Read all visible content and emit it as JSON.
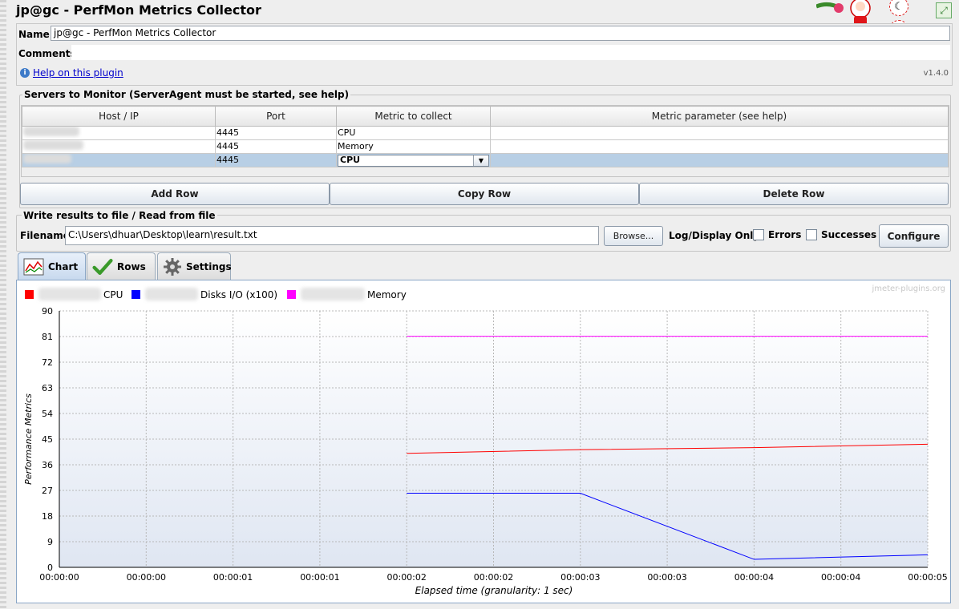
{
  "window": {
    "title": "jp@gc - PerfMon Metrics Collector"
  },
  "form": {
    "name_label": "Name:",
    "name_value": "jp@gc - PerfMon Metrics Collector",
    "comments_label": "Comments:",
    "help_link": "Help on this plugin",
    "version": "v1.4.0"
  },
  "servers": {
    "group_title": "Servers to Monitor (ServerAgent must be started, see help)",
    "columns": [
      "Host / IP",
      "Port",
      "Metric to collect",
      "Metric parameter (see help)"
    ],
    "rows": [
      {
        "host": "",
        "port": "4445",
        "metric": "CPU",
        "param": ""
      },
      {
        "host": "",
        "port": "4445",
        "metric": "Memory",
        "param": ""
      },
      {
        "host": "",
        "port": "4445",
        "metric": "CPU",
        "param": "",
        "selected": true
      }
    ],
    "add_row": "Add Row",
    "copy_row": "Copy Row",
    "delete_row": "Delete Row"
  },
  "file": {
    "group_title": "Write results to file / Read from file",
    "filename_label": "Filename",
    "filename_value": "C:\\Users\\dhuar\\Desktop\\learn\\result.txt",
    "browse": "Browse...",
    "log_display_label": "Log/Display Only:",
    "errors_label": "Errors",
    "successes_label": "Successes",
    "configure": "Configure"
  },
  "tabs": [
    {
      "label": "Chart",
      "icon": "chart-icon",
      "active": true
    },
    {
      "label": "Rows",
      "icon": "checkmark-icon",
      "active": false
    },
    {
      "label": "Settings",
      "icon": "gear-icon",
      "active": false
    }
  ],
  "chart_data": {
    "type": "line",
    "watermark": "jmeter-plugins.org",
    "xlabel": "Elapsed time (granularity: 1 sec)",
    "ylabel": "Performance Metrics",
    "ylim": [
      0,
      90
    ],
    "yticks": [
      0,
      9,
      18,
      27,
      36,
      45,
      54,
      63,
      72,
      81,
      90
    ],
    "xticks": [
      "00:00:00",
      "00:00:00",
      "00:00:01",
      "00:00:01",
      "00:00:02",
      "00:00:02",
      "00:00:03",
      "00:00:03",
      "00:00:04",
      "00:00:04",
      "00:00:05"
    ],
    "grid": true,
    "legend_position": "top-left",
    "series": [
      {
        "name": "CPU",
        "color": "#ff0000",
        "x": [
          2,
          3,
          4,
          5
        ],
        "values": [
          40,
          41.3,
          42,
          43.2
        ]
      },
      {
        "name": "Disks I/O (x100)",
        "color": "#0000ff",
        "x": [
          2,
          3,
          4,
          5
        ],
        "values": [
          26,
          26,
          2.8,
          4.4
        ]
      },
      {
        "name": "Memory",
        "color": "#ff00ff",
        "x": [
          2,
          3,
          4,
          5
        ],
        "values": [
          81.1,
          81.1,
          81.1,
          81.1
        ]
      }
    ]
  }
}
